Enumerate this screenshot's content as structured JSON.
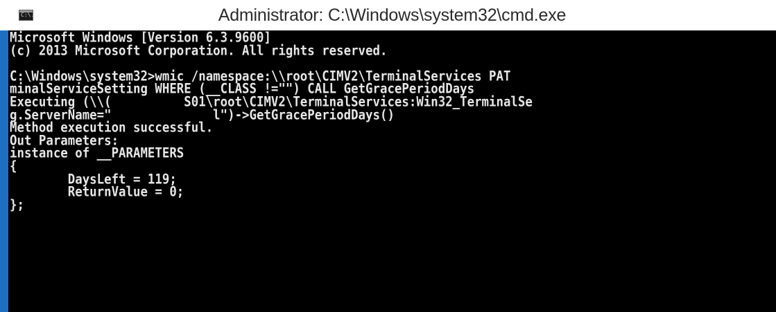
{
  "window": {
    "title": "Administrator: C:\\Windows\\system32\\cmd.exe",
    "icon": "cmd-icon",
    "icon_text": "C:\\."
  },
  "colors": {
    "console_bg": "#000000",
    "console_fg": "#e6e6e6",
    "frame": "#1e6fc4",
    "titlebar_bg": "#ffffff"
  },
  "console": {
    "lines": [
      "Microsoft Windows [Version 6.3.9600]",
      "(c) 2013 Microsoft Corporation. All rights reserved.",
      "",
      "C:\\Windows\\system32>wmic /namespace:\\\\root\\CIMV2\\TerminalServices PAT",
      "minalServiceSetting WHERE (__CLASS !=\"\") CALL GetGracePeriodDays",
      "Executing (\\\\(          S01\\root\\CIMV2\\TerminalServices:Win32_TerminalSe",
      "g.ServerName=\"              l\")->GetGracePeriodDays()",
      "Method execution successful.",
      "Out Parameters:",
      "instance of __PARAMETERS",
      "{",
      "        DaysLeft = 119;",
      "        ReturnValue = 0;",
      "};"
    ]
  }
}
